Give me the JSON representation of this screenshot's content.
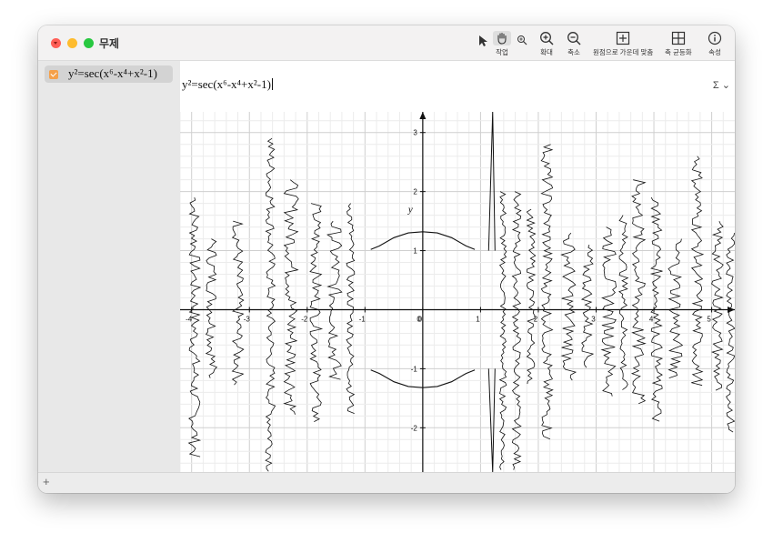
{
  "window": {
    "title": "무제"
  },
  "toolbar": {
    "work_label": "작업",
    "zoom_in_label": "확대",
    "zoom_out_label": "축소",
    "center_label": "원점으로 가운데 맞춤",
    "equalize_label": "축 균등화",
    "info_label": "속성"
  },
  "sidebar": {
    "equations": [
      {
        "checked": true,
        "label": "y²=sec(x⁶-x⁴+x²-1)",
        "color": "#f5a04a"
      }
    ],
    "add_label": "+"
  },
  "expression": {
    "text": "y²=sec(x⁶-x⁴+x²-1)",
    "menu_label": "Σ ⌄"
  },
  "chart_data": {
    "type": "line",
    "equation": "y^2 = sec(x^6 - x^4 + x^2 - 1)",
    "xlabel": "",
    "ylabel": "y",
    "xlim": [
      -4.2,
      5.4
    ],
    "ylim": [
      -2.75,
      3.35
    ],
    "x_ticks": [
      -4,
      -3,
      -2,
      -1,
      0,
      1,
      2,
      3,
      4,
      5
    ],
    "y_ticks": [
      -2,
      -1,
      1,
      2,
      3
    ],
    "grid": true,
    "series": [
      {
        "x": [
          -0.9,
          -0.75,
          -0.5,
          -0.25,
          0,
          0.25,
          0.5,
          0.75,
          0.9
        ],
        "y": [
          1.02,
          1.08,
          1.22,
          1.3,
          1.32,
          1.3,
          1.22,
          1.08,
          1.02
        ]
      },
      {
        "x": [
          -0.9,
          -0.75,
          -0.5,
          -0.25,
          0,
          0.25,
          0.5,
          0.75,
          0.9
        ],
        "y": [
          -1.02,
          -1.08,
          -1.22,
          -1.3,
          -1.32,
          -1.3,
          -1.22,
          -1.08,
          -1.02
        ]
      }
    ]
  }
}
